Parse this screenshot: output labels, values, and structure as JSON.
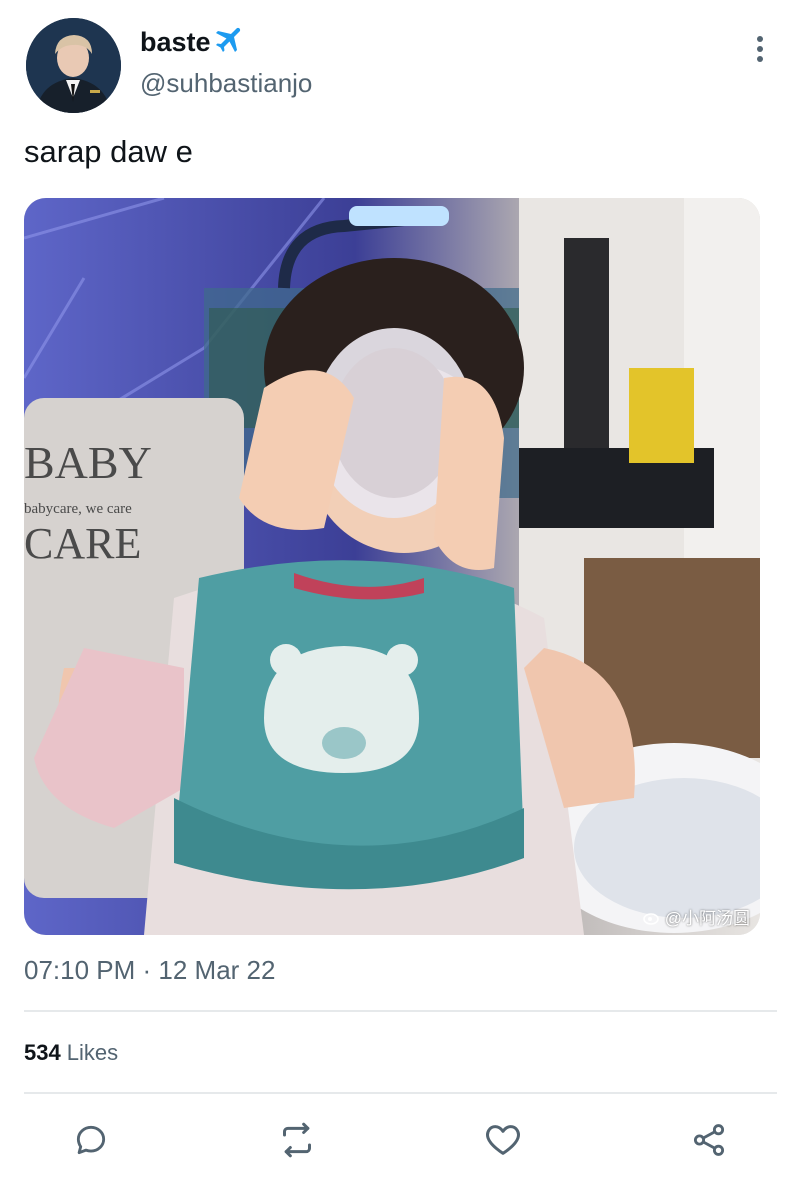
{
  "tweet": {
    "display_name": "baste",
    "name_emoji": "airplane-icon",
    "handle": "@suhbastianjo",
    "text": "sarap daw e",
    "timestamp": "07:10 PM · 12 Mar 22",
    "likes_count": "534",
    "likes_label": "Likes"
  },
  "media": {
    "chair_text_top": "BABY",
    "chair_text_mid": "babycare, we care",
    "chair_text_bottom": "CARE",
    "watermark": "@小阿汤圆"
  },
  "actions": [
    "reply-icon",
    "retweet-icon",
    "like-icon",
    "share-icon"
  ],
  "colors": {
    "text": "#0f1419",
    "secondary": "#536471",
    "divider": "#e6e9eb",
    "plane": "#1d9bf0"
  }
}
